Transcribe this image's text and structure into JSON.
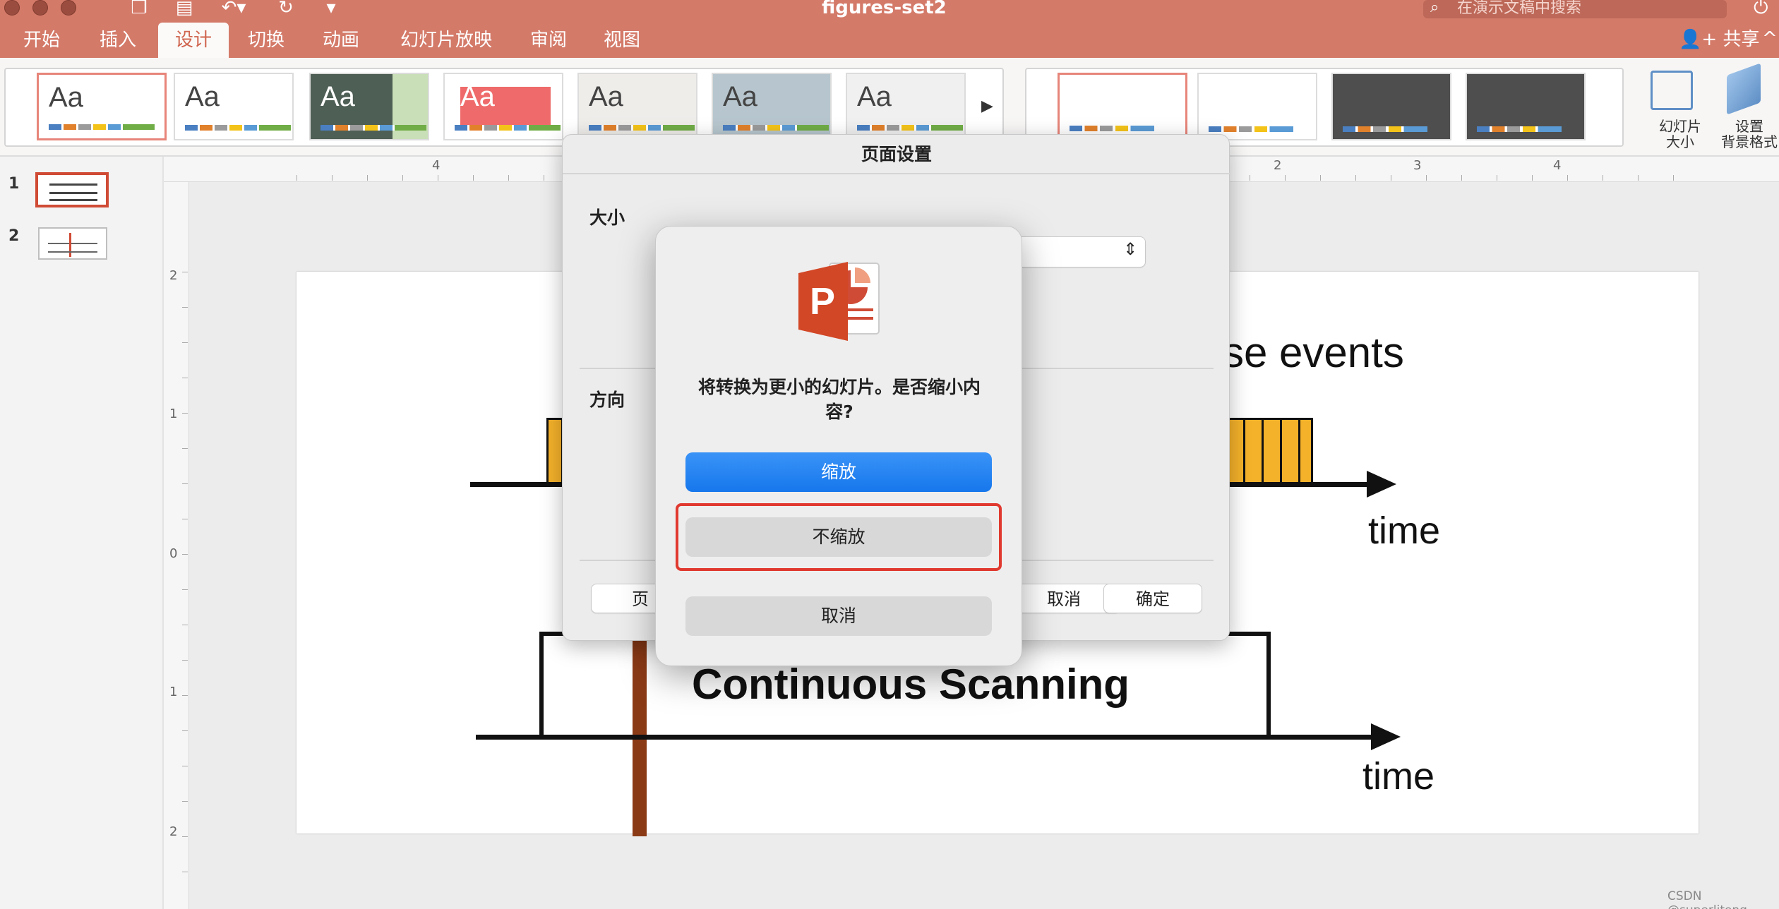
{
  "window": {
    "title": "figures-set2"
  },
  "search": {
    "placeholder": "在演示文稿中搜索"
  },
  "tabs": [
    {
      "label": "开始"
    },
    {
      "label": "插入"
    },
    {
      "label": "设计"
    },
    {
      "label": "切换"
    },
    {
      "label": "动画"
    },
    {
      "label": "幻灯片放映"
    },
    {
      "label": "审阅"
    },
    {
      "label": "视图"
    }
  ],
  "active_tab": "设计",
  "share": {
    "label": "共享"
  },
  "themes": [
    {
      "sample": "Aa"
    },
    {
      "sample": "Aa"
    },
    {
      "sample": "Aa"
    },
    {
      "sample": "Aa"
    },
    {
      "sample": "Aa"
    },
    {
      "sample": "Aa"
    },
    {
      "sample": "Aa"
    }
  ],
  "ribbon": {
    "slide_size_label": "幻灯片\n大小",
    "format_bg_label": "设置\n背景格式"
  },
  "thumbnails": [
    {
      "num": "1"
    },
    {
      "num": "2"
    }
  ],
  "rulers": {
    "h_ticks": [
      "4",
      "2",
      "3",
      "4"
    ],
    "v_ticks": [
      "2",
      "1",
      "0",
      "1",
      "2"
    ]
  },
  "slide": {
    "heading_fragment": "se events",
    "time_label_top": "time",
    "time_label_bottom": "time",
    "box_label": "Continuous Scanning"
  },
  "page_setup": {
    "title": "页面设置",
    "size_label": "大小",
    "orientation_label": "方向",
    "page_button_fragment": "页",
    "cancel_fragment": "取消",
    "ok": "确定"
  },
  "alert": {
    "icon": "powerpoint-app-icon",
    "message": "将转换为更小的幻灯片。是否缩小内容?",
    "scale_button": "缩放",
    "no_scale_button": "不缩放",
    "cancel_button": "取消"
  },
  "watermark": "CSDN @superlitong",
  "colors": {
    "accent": "#d47a69",
    "primary_button": "#1a7ff0",
    "highlight_box": "#e0392f",
    "event_bar": "#f4b12a",
    "marker": "#8b3a16"
  }
}
